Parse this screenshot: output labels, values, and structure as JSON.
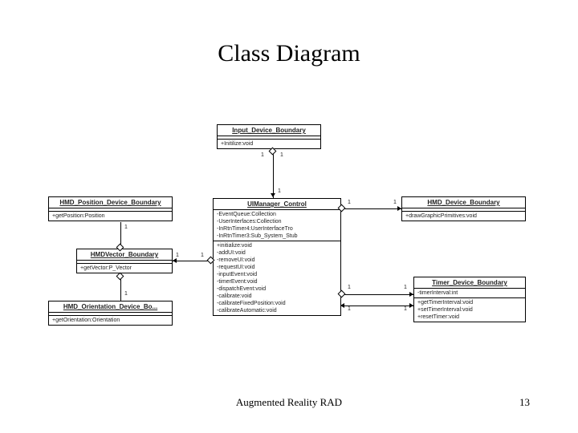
{
  "title": "Class Diagram",
  "footer": {
    "caption": "Augmented Reality RAD",
    "page": "13"
  },
  "classes": {
    "input_device": {
      "name": "Input_Device_Boundary",
      "ops": [
        "+Initilize:void"
      ]
    },
    "hmd_position": {
      "name": "HMD_Position_Device_Boundary",
      "ops": [
        "+getPosition:Position"
      ]
    },
    "hmd_vector": {
      "name": "HMDVector_Boundary",
      "ops": [
        "+getVector:P_Vector"
      ]
    },
    "hmd_orientation": {
      "name": "HMD_Orientation_Device_Bo...",
      "ops": [
        "+getOrientation:Orientation"
      ]
    },
    "ui_manager": {
      "name": "UIManager_Control",
      "attrs": [
        "-EventQueue:Collection",
        "-UserInterfaces:Collection",
        "-InRtnTimer4:UserInterfaceTro",
        "-InRtnTimer3:Sub_System_Stub"
      ],
      "ops": [
        "+initialize:void",
        "-addUI:void",
        "-removeUI:void",
        "-requestUI:void",
        "-inputEvent:void",
        "-timerEvent:void",
        "-dispatchEvent:void",
        "-calibrate:void",
        "-calibrateFixedPosition:void",
        "-calibrateAutomatic:void"
      ]
    },
    "hmd_device": {
      "name": "HMD_Device_Boundary",
      "ops": [
        "+drawGraphicPrimitives:void"
      ]
    },
    "timer_device": {
      "name": "Timer_Device_Boundary",
      "attrs": [
        "-timerInterval:int"
      ],
      "ops": [
        "+getTimerInterval:void",
        "+setTimerInterval:void",
        "+resetTimer:void"
      ]
    }
  },
  "multiplicities": {
    "one_a": "1",
    "one_b": "1",
    "one_c": "1",
    "one_d": "1",
    "one_e": "1",
    "one_f": "1",
    "one_g": "1",
    "one_h": "1",
    "one_i": "1",
    "one_j": "1"
  }
}
